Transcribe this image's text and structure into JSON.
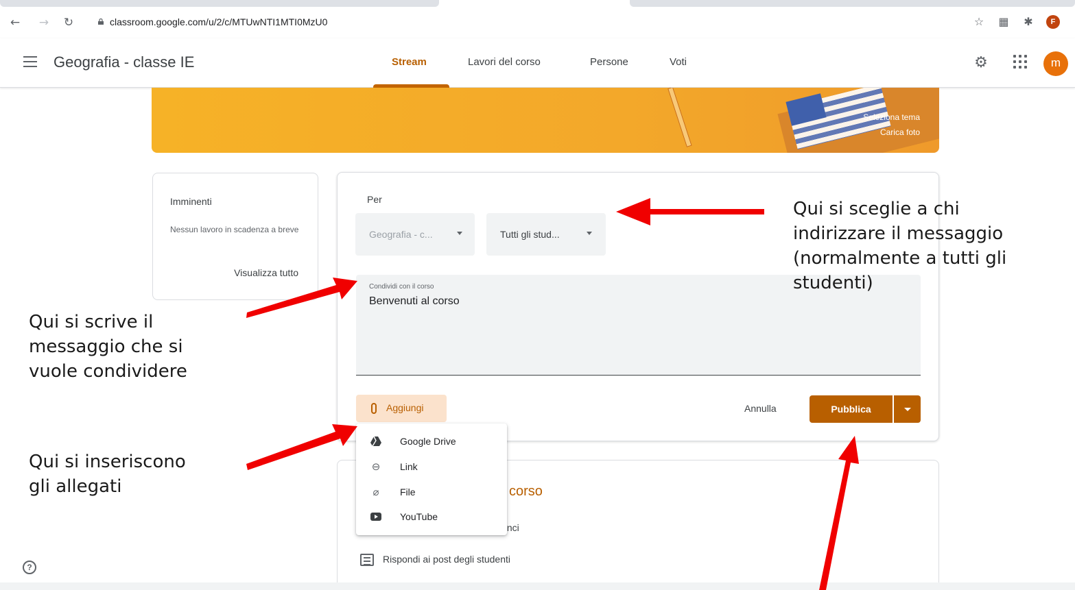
{
  "browser": {
    "url": "classroom.google.com/u/2/c/MTUwNTI1MTI0MzU0",
    "profile_initial": "F"
  },
  "header": {
    "course_title": "Geografia - classe IE",
    "tabs": [
      {
        "label": "Stream",
        "active": true
      },
      {
        "label": "Lavori del corso",
        "active": false
      },
      {
        "label": "Persone",
        "active": false
      },
      {
        "label": "Voti",
        "active": false
      }
    ],
    "avatar_initial": "m"
  },
  "banner": {
    "select_theme": "Seleziona tema",
    "upload_photo": "Carica foto"
  },
  "upcoming": {
    "title": "Imminenti",
    "text": "Nessun lavoro in scadenza a breve",
    "view_all": "Visualizza tutto"
  },
  "compose": {
    "for_label": "Per",
    "course_select": "Geografia - c...",
    "students_select": "Tutti gli stud...",
    "share_label": "Condividi con il corso",
    "share_value": "Benvenuti al corso",
    "add_label": "Aggiungi",
    "cancel_label": "Annulla",
    "publish_label": "Pubblica"
  },
  "attach_menu": [
    {
      "label": "Google Drive",
      "icon": "drive-icon"
    },
    {
      "label": "Link",
      "icon": "link-icon"
    },
    {
      "label": "File",
      "icon": "paperclip-icon"
    },
    {
      "label": "YouTube",
      "icon": "youtube-icon"
    }
  ],
  "info_card": {
    "heading": "l corso",
    "line1": "ınci",
    "line2": "Rispondi ai post degli studenti"
  },
  "annotations": {
    "recipients": "Qui si sceglie a chi indirizzare il messaggio (normalmente a tutti gli studenti)",
    "recipients_lines": [
      "Qui si sceglie a chi",
      "indirizzare il messaggio",
      "(normalmente a tutti gli",
      "studenti)"
    ],
    "message_lines": [
      "Qui si scrive il",
      "messaggio che si",
      "vuole condividere"
    ],
    "attachments_lines": [
      "Qui si inseriscono",
      "gli allegati"
    ]
  },
  "colors": {
    "accent": "#b85f00",
    "banner": "#f3a82a",
    "arrow": "#f00000"
  }
}
